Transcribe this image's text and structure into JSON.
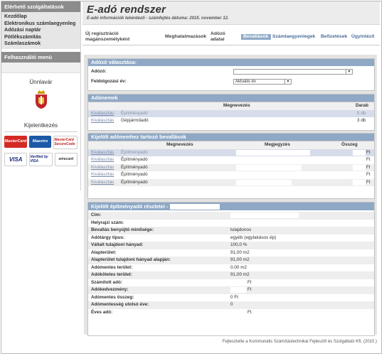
{
  "sidebar": {
    "services_heading": "Elérhető szolgáltatások",
    "links": [
      "Kezdőlap",
      "Elektronikus számlaegyenleg",
      "Adózási naptár",
      "Pótlékszámítás",
      "Számlaszámok"
    ],
    "user_menu_heading": "Felhasználói menü",
    "location": "Ünnlavár",
    "payment_heading": "Kijelentkezés",
    "cards": [
      "MasterCard",
      "Maestro",
      "MasterCard SecureCode",
      "VISA",
      "Verified by VISA",
      "wirecard"
    ]
  },
  "header": {
    "title": "E-adó rendszer",
    "subtitle": "E-adó információk lekérdező - számfejtés dátuma: 2015. november 12."
  },
  "nav": {
    "new_registration_line1": "Új regisztráció",
    "new_registration_line2": "magánszemélyként",
    "authorizations": "Meghatalmazások",
    "tax_data_line1": "Adózó",
    "tax_data_line2": "adatai",
    "declarations": "Bevallások",
    "account_balances": "Számlaegyenlegek",
    "payments": "Befizetések",
    "cases": "Ügyintéző"
  },
  "taxpayer_select": {
    "title": "Adózó választása:",
    "taxpayer_label": "Adózó:",
    "year_label": "Feldolgozási év:",
    "year_value": "Aktuális év"
  },
  "tax_types": {
    "title": "Adónemek",
    "col_name": "Megnevezés",
    "col_count": "Darab",
    "rows": [
      {
        "action": "Kiválasztás",
        "name": "Építményadó",
        "count": "5 db"
      },
      {
        "action": "Kiválasztás",
        "name": "Gépjárműadó",
        "count": "3 db"
      }
    ]
  },
  "declarations": {
    "title": "Kijelölt adónemhez tartozó bevallások",
    "col_name": "Megnevezés",
    "col_note": "Megjegyzés",
    "col_amount": "Összeg",
    "rows": [
      {
        "action": "Kiválasztás",
        "name": "Építményadó",
        "currency": "Ft"
      },
      {
        "action": "Kiválasztás",
        "name": "Építményadó",
        "currency": "Ft"
      },
      {
        "action": "Kiválasztás",
        "name": "Építményadó",
        "currency": "Ft"
      },
      {
        "action": "Kiválasztás",
        "name": "Építményadó",
        "currency": "Ft"
      },
      {
        "action": "Kiválasztás",
        "name": "Építményadó",
        "currency": "Ft"
      }
    ]
  },
  "details": {
    "title": "Kijelölt építményadó részletei -",
    "fields": [
      {
        "label": "Cím:",
        "value": ""
      },
      {
        "label": "Helyrajzi szám:",
        "value": ""
      },
      {
        "label": "Bevallás benyújtó minősége:",
        "value": "tulajdonos"
      },
      {
        "label": "Adótárgy típus:",
        "value": "egyéb (egylakásos ép)"
      },
      {
        "label": "Vállalt tulajdoni hányad:",
        "value": "100,0 %"
      },
      {
        "label": "Alapterület:",
        "value": "91,00 m2"
      },
      {
        "label": "Alapterület tulajdoni hányad alapján:",
        "value": "91,00 m2"
      },
      {
        "label": "Adómentes terület:",
        "value": "0,00 m2"
      },
      {
        "label": "Adóköteles terület:",
        "value": "91,00 m2"
      },
      {
        "label": "Számított adó:",
        "value": "Ft"
      },
      {
        "label": "Adókedvezmény:",
        "value": "Ft"
      },
      {
        "label": "Adómentes összeg:",
        "value": "0 Ft"
      },
      {
        "label": "Adómentesség utolsó éve:",
        "value": "0"
      },
      {
        "label": "Éves adó:",
        "value": "Ft"
      }
    ]
  },
  "footer": "Fejlesztette a Kommunális Számítástechnikai Fejlesztő és Szolgáltató Kft. (2010.)",
  "colors": {
    "panel_title": "#8ea8c5",
    "sidebar_head": "#8c8c8c",
    "link": "#7a8aa8"
  }
}
